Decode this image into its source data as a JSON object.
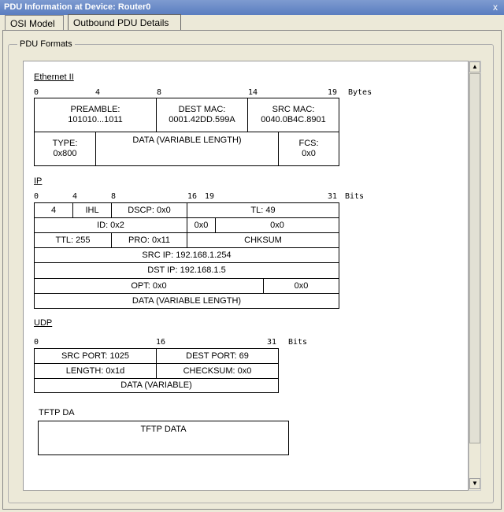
{
  "window": {
    "title": "PDU Information at Device: Router0",
    "close": "x"
  },
  "tabs": [
    {
      "label": "OSI Model"
    },
    {
      "label": "Outbound PDU Details"
    }
  ],
  "group": {
    "label": "PDU Formats"
  },
  "ethernet": {
    "title": "Ethernet II",
    "ticks": [
      "0",
      "4",
      "8",
      "14",
      "19"
    ],
    "unit": "Bytes",
    "preamble": {
      "label": "PREAMBLE:",
      "value": "101010...1011"
    },
    "dest_mac": {
      "label": "DEST MAC:",
      "value": "0001.42DD.599A"
    },
    "src_mac": {
      "label": "SRC MAC:",
      "value": "0040.0B4C.8901"
    },
    "type": {
      "label": "TYPE:",
      "value": "0x800"
    },
    "data": "DATA (VARIABLE LENGTH)",
    "fcs": {
      "label": "FCS:",
      "value": "0x0"
    }
  },
  "ip": {
    "title": "IP",
    "ticks": [
      "0",
      "4",
      "8",
      "16",
      "19",
      "31"
    ],
    "unit": "Bits",
    "version": "4",
    "ihl": "IHL",
    "dscp": "DSCP: 0x0",
    "tl": "TL: 49",
    "id": "ID: 0x2",
    "flags": "0x0",
    "frag": "0x0",
    "ttl": "TTL: 255",
    "pro": "PRO: 0x11",
    "chksum": "CHKSUM",
    "src_ip": "SRC IP: 192.168.1.254",
    "dst_ip": "DST IP: 192.168.1.5",
    "opt": "OPT: 0x0",
    "pad": "0x0",
    "data": "DATA (VARIABLE LENGTH)"
  },
  "udp": {
    "title": "UDP",
    "ticks": [
      "0",
      "16",
      "31"
    ],
    "unit": "Bits",
    "src_port": "SRC PORT: 1025",
    "dest_port": "DEST PORT: 69",
    "length": "LENGTH: 0x1d",
    "checksum": "CHECKSUM: 0x0",
    "data": "DATA (VARIABLE)"
  },
  "tftp": {
    "title": "TFTP DA",
    "data": "TFTP DATA"
  },
  "scrollbar": {
    "up": "▲",
    "down": "▼"
  }
}
